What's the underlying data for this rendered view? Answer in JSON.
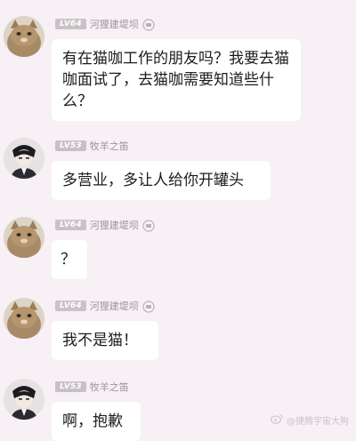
{
  "messages": [
    {
      "level": "LV64",
      "username": "河狸建堤坝",
      "text": "有在猫咖工作的朋友吗？我要去猫咖面试了，去猫咖需要知道些什么？",
      "avatar": "cat-avatar"
    },
    {
      "level": "LV53",
      "username": "牧羊之笛",
      "text": "多营业，多让人给你开罐头",
      "avatar": "person-avatar"
    },
    {
      "level": "LV64",
      "username": "河狸建堤坝",
      "text": "？",
      "avatar": "cat-avatar"
    },
    {
      "level": "LV64",
      "username": "河狸建堤坝",
      "text": "我不是猫！",
      "avatar": "cat-avatar"
    },
    {
      "level": "LV53",
      "username": "牧羊之笛",
      "text": "啊，抱歉",
      "avatar": "person-avatar"
    }
  ],
  "watermark": {
    "text": "@捷腾宇宙大狗",
    "icon": "weibo-icon"
  },
  "colors": {
    "background": "#f7f0f5",
    "bubble": "#ffffff",
    "username": "#9b959a",
    "badge": "#c9c2c7"
  }
}
